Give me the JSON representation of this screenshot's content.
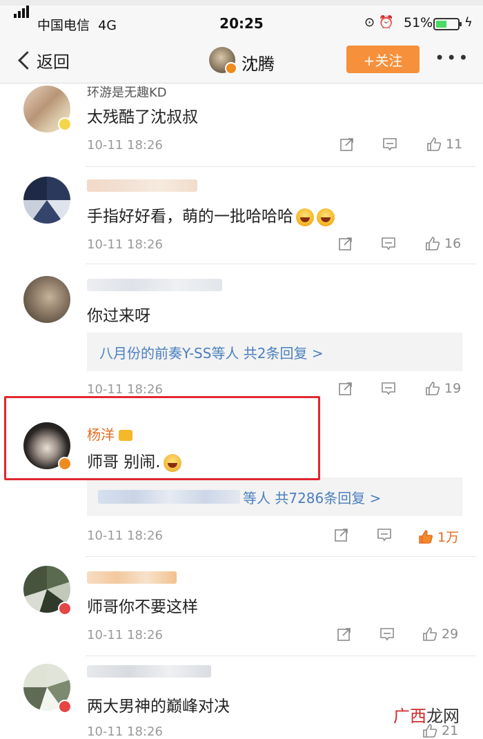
{
  "status_bar": {
    "carrier": "中国电信",
    "network": "4G",
    "time": "20:25",
    "battery_percent": "51%",
    "battery_level": 0.51
  },
  "nav": {
    "back_label": "返回",
    "title": "沈腾",
    "follow_label": "+关注",
    "more_label": "•••"
  },
  "comments": [
    {
      "name": "环游是无趣KD",
      "text": "太残酷了沈叔叔",
      "time": "10-11 18:26",
      "likes": "11"
    },
    {
      "name": "",
      "text": "手指好好看，萌的一批哈哈哈",
      "time": "10-11 18:26",
      "likes": "16"
    },
    {
      "name": "",
      "text": "你过来呀",
      "replies_text": "八月份的前奏Y-SS等人  共2条回复 >",
      "time": "10-11 18:26",
      "likes": "19"
    },
    {
      "name": "杨洋",
      "text": "师哥 别闹.",
      "replies_text": "等人  共7286条回复 >",
      "time": "10-11 18:26",
      "likes": "1万"
    },
    {
      "name": "",
      "text": "师哥你不要这样",
      "time": "10-11 18:26",
      "likes": "29"
    },
    {
      "name": "",
      "text": "两大男神的巅峰对决",
      "time": "10-11 18:26",
      "likes": "21"
    }
  ],
  "watermark": {
    "part1": "广西",
    "part2": "龙网"
  },
  "colors": {
    "follow_bg": "#f7903a",
    "name_orange": "#e36b1f",
    "link_blue": "#4a7fbf",
    "highlight_red": "#e0262f"
  }
}
